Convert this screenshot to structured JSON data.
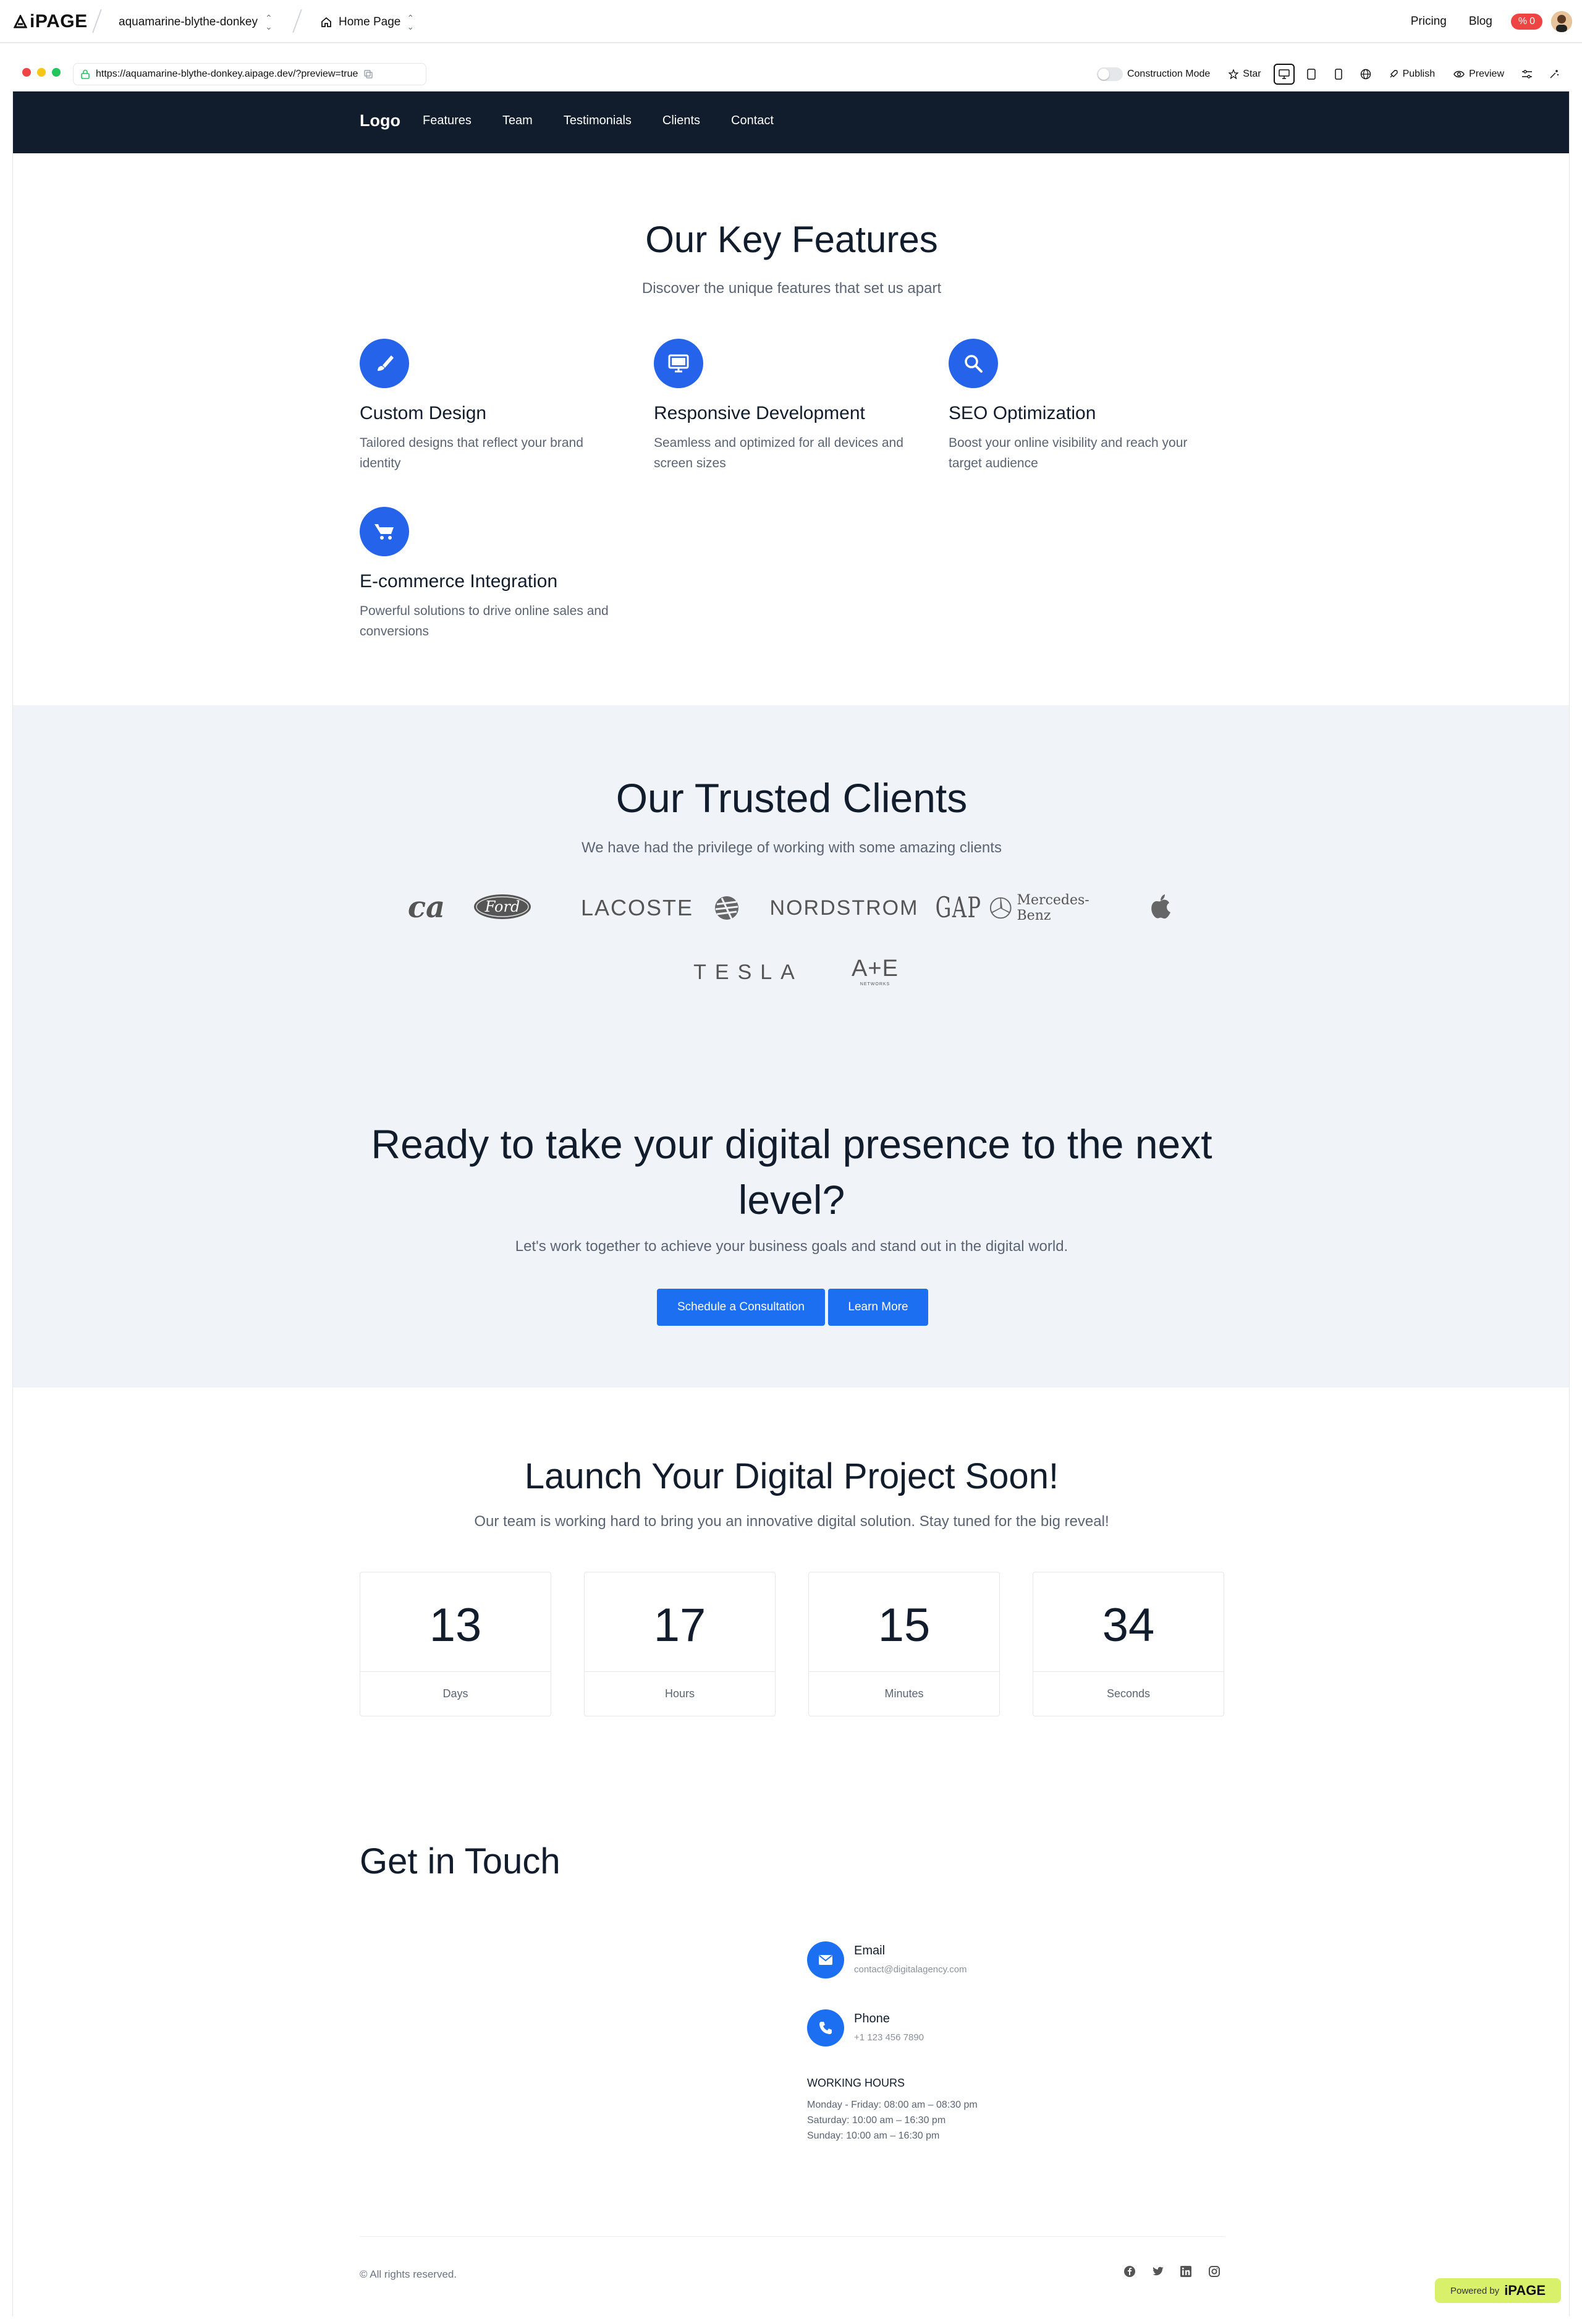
{
  "app": {
    "logo_text": "iPAGE",
    "project_name": "aquamarine-blythe-donkey",
    "page_name": "Home Page",
    "nav": {
      "pricing": "Pricing",
      "blog": "Blog",
      "badge_count": "0"
    }
  },
  "browser": {
    "url": "https://aquamarine-blythe-donkey.aipage.dev/?preview=true",
    "construction_mode": "Construction Mode",
    "star": "Star",
    "publish": "Publish",
    "preview": "Preview"
  },
  "site": {
    "nav": {
      "logo": "Logo",
      "items": [
        "Features",
        "Team",
        "Testimonials",
        "Clients",
        "Contact"
      ]
    },
    "features": {
      "title": "Our Key Features",
      "subtitle": "Discover the unique features that set us apart",
      "items": [
        {
          "icon": "paintbrush-icon",
          "title": "Custom Design",
          "desc_1": "Tailored designs that reflect your brand",
          "desc_2": "identity"
        },
        {
          "icon": "monitor-icon",
          "title": "Responsive Development",
          "desc_1": "Seamless and optimized for all devices and",
          "desc_2": "screen sizes"
        },
        {
          "icon": "search-icon",
          "title": "SEO Optimization",
          "desc_1": "Boost your online visibility and reach your",
          "desc_2": "target audience"
        },
        {
          "icon": "cart-icon",
          "title": "E-commerce Integration",
          "desc_1": "Powerful solutions to drive online sales and",
          "desc_2": "conversions"
        }
      ]
    },
    "clients": {
      "title": "Our Trusted Clients",
      "subtitle": "We have had the privilege of working with some amazing clients",
      "logos": [
        "ca",
        "Ford",
        "LACOSTE",
        "NORDSTROM",
        "GAP",
        "Mercedes-Benz",
        "TESLA",
        "A+E",
        "NETWORKS"
      ]
    },
    "cta": {
      "title_1": "Ready to take your digital presence to the next",
      "title_2": "level?",
      "subtitle": "Let's work together to achieve your business goals and stand out in the digital world.",
      "primary": "Schedule a Consultation",
      "secondary": "Learn More"
    },
    "launch": {
      "title": "Launch Your Digital Project Soon!",
      "subtitle": "Our team is working hard to bring you an innovative digital solution. Stay tuned for the big reveal!",
      "countdown": [
        {
          "value": "13",
          "label": "Days"
        },
        {
          "value": "17",
          "label": "Hours"
        },
        {
          "value": "15",
          "label": "Minutes"
        },
        {
          "value": "34",
          "label": "Seconds"
        }
      ]
    },
    "contact": {
      "title": "Get in Touch",
      "email_label": "Email",
      "email": "contact@digitalagency.com",
      "phone_label": "Phone",
      "phone": "+1 123 456 7890",
      "hours_title": "WORKING HOURS",
      "hours": [
        "Monday - Friday: 08:00 am – 08:30 pm",
        "Saturday: 10:00 am – 16:30 pm",
        "Sunday: 10:00 am – 16:30 pm"
      ]
    },
    "footer": {
      "copyright": "© All rights reserved."
    },
    "powered_by": {
      "label": "Powered by",
      "brand": "iPAGE"
    }
  },
  "colors": {
    "nav_bg": "#111c2d",
    "accent": "#1d6ff2",
    "clients_bg": "#f0f4f8",
    "badge": "#ef4444",
    "powered_bg": "#d9f06b"
  }
}
